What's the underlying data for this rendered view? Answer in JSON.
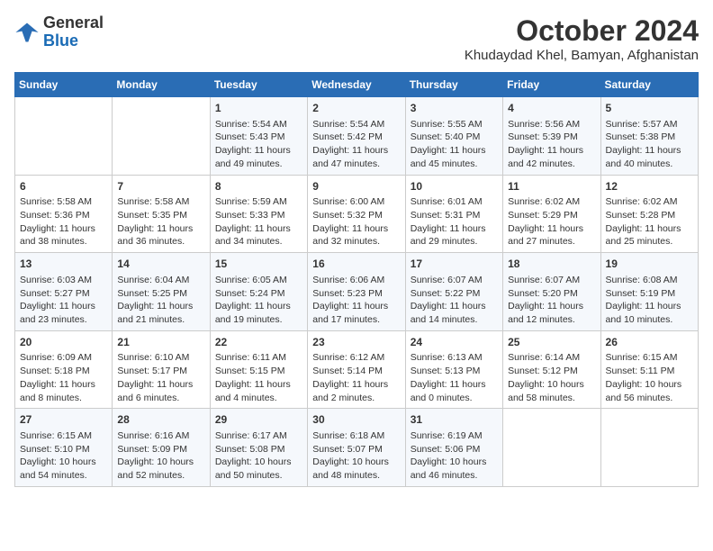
{
  "header": {
    "logo_line1": "General",
    "logo_line2": "Blue",
    "month_title": "October 2024",
    "location": "Khudaydad Khel, Bamyan, Afghanistan"
  },
  "weekdays": [
    "Sunday",
    "Monday",
    "Tuesday",
    "Wednesday",
    "Thursday",
    "Friday",
    "Saturday"
  ],
  "weeks": [
    [
      {
        "day": "",
        "content": ""
      },
      {
        "day": "",
        "content": ""
      },
      {
        "day": "1",
        "content": "Sunrise: 5:54 AM\nSunset: 5:43 PM\nDaylight: 11 hours and 49 minutes."
      },
      {
        "day": "2",
        "content": "Sunrise: 5:54 AM\nSunset: 5:42 PM\nDaylight: 11 hours and 47 minutes."
      },
      {
        "day": "3",
        "content": "Sunrise: 5:55 AM\nSunset: 5:40 PM\nDaylight: 11 hours and 45 minutes."
      },
      {
        "day": "4",
        "content": "Sunrise: 5:56 AM\nSunset: 5:39 PM\nDaylight: 11 hours and 42 minutes."
      },
      {
        "day": "5",
        "content": "Sunrise: 5:57 AM\nSunset: 5:38 PM\nDaylight: 11 hours and 40 minutes."
      }
    ],
    [
      {
        "day": "6",
        "content": "Sunrise: 5:58 AM\nSunset: 5:36 PM\nDaylight: 11 hours and 38 minutes."
      },
      {
        "day": "7",
        "content": "Sunrise: 5:58 AM\nSunset: 5:35 PM\nDaylight: 11 hours and 36 minutes."
      },
      {
        "day": "8",
        "content": "Sunrise: 5:59 AM\nSunset: 5:33 PM\nDaylight: 11 hours and 34 minutes."
      },
      {
        "day": "9",
        "content": "Sunrise: 6:00 AM\nSunset: 5:32 PM\nDaylight: 11 hours and 32 minutes."
      },
      {
        "day": "10",
        "content": "Sunrise: 6:01 AM\nSunset: 5:31 PM\nDaylight: 11 hours and 29 minutes."
      },
      {
        "day": "11",
        "content": "Sunrise: 6:02 AM\nSunset: 5:29 PM\nDaylight: 11 hours and 27 minutes."
      },
      {
        "day": "12",
        "content": "Sunrise: 6:02 AM\nSunset: 5:28 PM\nDaylight: 11 hours and 25 minutes."
      }
    ],
    [
      {
        "day": "13",
        "content": "Sunrise: 6:03 AM\nSunset: 5:27 PM\nDaylight: 11 hours and 23 minutes."
      },
      {
        "day": "14",
        "content": "Sunrise: 6:04 AM\nSunset: 5:25 PM\nDaylight: 11 hours and 21 minutes."
      },
      {
        "day": "15",
        "content": "Sunrise: 6:05 AM\nSunset: 5:24 PM\nDaylight: 11 hours and 19 minutes."
      },
      {
        "day": "16",
        "content": "Sunrise: 6:06 AM\nSunset: 5:23 PM\nDaylight: 11 hours and 17 minutes."
      },
      {
        "day": "17",
        "content": "Sunrise: 6:07 AM\nSunset: 5:22 PM\nDaylight: 11 hours and 14 minutes."
      },
      {
        "day": "18",
        "content": "Sunrise: 6:07 AM\nSunset: 5:20 PM\nDaylight: 11 hours and 12 minutes."
      },
      {
        "day": "19",
        "content": "Sunrise: 6:08 AM\nSunset: 5:19 PM\nDaylight: 11 hours and 10 minutes."
      }
    ],
    [
      {
        "day": "20",
        "content": "Sunrise: 6:09 AM\nSunset: 5:18 PM\nDaylight: 11 hours and 8 minutes."
      },
      {
        "day": "21",
        "content": "Sunrise: 6:10 AM\nSunset: 5:17 PM\nDaylight: 11 hours and 6 minutes."
      },
      {
        "day": "22",
        "content": "Sunrise: 6:11 AM\nSunset: 5:15 PM\nDaylight: 11 hours and 4 minutes."
      },
      {
        "day": "23",
        "content": "Sunrise: 6:12 AM\nSunset: 5:14 PM\nDaylight: 11 hours and 2 minutes."
      },
      {
        "day": "24",
        "content": "Sunrise: 6:13 AM\nSunset: 5:13 PM\nDaylight: 11 hours and 0 minutes."
      },
      {
        "day": "25",
        "content": "Sunrise: 6:14 AM\nSunset: 5:12 PM\nDaylight: 10 hours and 58 minutes."
      },
      {
        "day": "26",
        "content": "Sunrise: 6:15 AM\nSunset: 5:11 PM\nDaylight: 10 hours and 56 minutes."
      }
    ],
    [
      {
        "day": "27",
        "content": "Sunrise: 6:15 AM\nSunset: 5:10 PM\nDaylight: 10 hours and 54 minutes."
      },
      {
        "day": "28",
        "content": "Sunrise: 6:16 AM\nSunset: 5:09 PM\nDaylight: 10 hours and 52 minutes."
      },
      {
        "day": "29",
        "content": "Sunrise: 6:17 AM\nSunset: 5:08 PM\nDaylight: 10 hours and 50 minutes."
      },
      {
        "day": "30",
        "content": "Sunrise: 6:18 AM\nSunset: 5:07 PM\nDaylight: 10 hours and 48 minutes."
      },
      {
        "day": "31",
        "content": "Sunrise: 6:19 AM\nSunset: 5:06 PM\nDaylight: 10 hours and 46 minutes."
      },
      {
        "day": "",
        "content": ""
      },
      {
        "day": "",
        "content": ""
      }
    ]
  ]
}
